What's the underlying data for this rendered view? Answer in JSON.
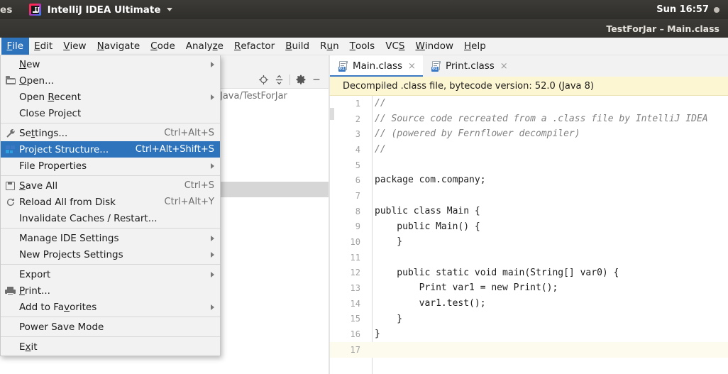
{
  "os_panel": {
    "activities_label": "es",
    "app_name": "IntelliJ IDEA Ultimate",
    "caret_icon": "chevron-down-icon",
    "logo_icon": "intellij-idea-logo",
    "clock": "Sun 16:57",
    "indicator_icon": "status-dot-icon"
  },
  "ide_titlebar": {
    "title": "TestForJar – Main.class"
  },
  "menubar": {
    "items": [
      {
        "label": "File",
        "mnemonic": "F",
        "active": true
      },
      {
        "label": "Edit",
        "mnemonic": "E",
        "active": false
      },
      {
        "label": "View",
        "mnemonic": "V",
        "active": false
      },
      {
        "label": "Navigate",
        "mnemonic": "N",
        "active": false
      },
      {
        "label": "Code",
        "mnemonic": "C",
        "active": false
      },
      {
        "label": "Analyze",
        "mnemonic": "z",
        "active": false
      },
      {
        "label": "Refactor",
        "mnemonic": "R",
        "active": false
      },
      {
        "label": "Build",
        "mnemonic": "B",
        "active": false
      },
      {
        "label": "Run",
        "mnemonic": "u",
        "active": false
      },
      {
        "label": "Tools",
        "mnemonic": "T",
        "active": false
      },
      {
        "label": "VCS",
        "mnemonic": "S",
        "active": false
      },
      {
        "label": "Window",
        "mnemonic": "W",
        "active": false
      },
      {
        "label": "Help",
        "mnemonic": "H",
        "active": false
      }
    ]
  },
  "file_menu": {
    "name": "File",
    "items": [
      {
        "label": "New",
        "mnemonic": "N",
        "icon": null,
        "accel": "",
        "submenu": true,
        "selected": false
      },
      {
        "label": "Open...",
        "mnemonic": "O",
        "icon": "folder-icon",
        "accel": "",
        "submenu": false,
        "selected": false
      },
      {
        "label": "Open Recent",
        "mnemonic": "R",
        "icon": null,
        "accel": "",
        "submenu": true,
        "selected": false
      },
      {
        "label": "Close Project",
        "mnemonic": "",
        "icon": null,
        "accel": "",
        "submenu": false,
        "selected": false
      },
      {
        "separator": true
      },
      {
        "label": "Settings...",
        "mnemonic": "t",
        "icon": "wrench-icon",
        "accel": "Ctrl+Alt+S",
        "submenu": false,
        "selected": false
      },
      {
        "label": "Project Structure...",
        "mnemonic": "",
        "icon": "project-structure-icon",
        "accel": "Ctrl+Alt+Shift+S",
        "submenu": false,
        "selected": true
      },
      {
        "label": "File Properties",
        "mnemonic": "",
        "icon": null,
        "accel": "",
        "submenu": true,
        "selected": false
      },
      {
        "separator": true
      },
      {
        "label": "Save All",
        "mnemonic": "S",
        "icon": "save-icon",
        "accel": "Ctrl+S",
        "submenu": false,
        "selected": false
      },
      {
        "label": "Reload All from Disk",
        "mnemonic": "",
        "icon": "reload-icon",
        "accel": "Ctrl+Alt+Y",
        "submenu": false,
        "selected": false
      },
      {
        "label": "Invalidate Caches / Restart...",
        "mnemonic": "",
        "icon": null,
        "accel": "",
        "submenu": false,
        "selected": false
      },
      {
        "separator": true
      },
      {
        "label": "Manage IDE Settings",
        "mnemonic": "",
        "icon": null,
        "accel": "",
        "submenu": true,
        "selected": false
      },
      {
        "label": "New Projects Settings",
        "mnemonic": "",
        "icon": null,
        "accel": "",
        "submenu": true,
        "selected": false
      },
      {
        "separator": true
      },
      {
        "label": "Export",
        "mnemonic": "",
        "icon": null,
        "accel": "",
        "submenu": true,
        "selected": false
      },
      {
        "label": "Print...",
        "mnemonic": "P",
        "icon": "printer-icon",
        "accel": "",
        "submenu": false,
        "selected": false
      },
      {
        "label": "Add to Favorites",
        "mnemonic": "v",
        "icon": null,
        "accel": "",
        "submenu": true,
        "selected": false
      },
      {
        "separator": true
      },
      {
        "label": "Power Save Mode",
        "mnemonic": "",
        "icon": null,
        "accel": "",
        "submenu": false,
        "selected": false
      },
      {
        "separator": true
      },
      {
        "label": "Exit",
        "mnemonic": "x",
        "icon": null,
        "accel": "",
        "submenu": false,
        "selected": false
      }
    ]
  },
  "project_panel": {
    "path_label": "Java/TestForJar",
    "toolbar_icons": [
      "locate-target-icon",
      "collapse-all-icon",
      "gear-icon",
      "hide-panel-icon"
    ]
  },
  "editor": {
    "tabs": [
      {
        "label": "Main.class",
        "icon": "java-class-file-icon",
        "badge": "01",
        "active": true,
        "close_icon": "close-icon"
      },
      {
        "label": "Print.class",
        "icon": "java-class-file-icon",
        "badge": "01",
        "active": false,
        "close_icon": "close-icon"
      }
    ],
    "banner": "Decompiled .class file, bytecode version: 52.0 (Java 8)",
    "lines": [
      {
        "n": "1",
        "text": "//",
        "style": "cmt",
        "caret": false
      },
      {
        "n": "2",
        "text": "// Source code recreated from a .class file by IntelliJ IDEA",
        "style": "cmt",
        "caret": false
      },
      {
        "n": "3",
        "text": "// (powered by Fernflower decompiler)",
        "style": "cmt",
        "caret": false
      },
      {
        "n": "4",
        "text": "//",
        "style": "cmt",
        "caret": false
      },
      {
        "n": "5",
        "text": "",
        "style": "",
        "caret": false
      },
      {
        "n": "6",
        "text": "package com.company;",
        "style": "",
        "caret": false
      },
      {
        "n": "7",
        "text": "",
        "style": "",
        "caret": false
      },
      {
        "n": "8",
        "text": "public class Main {",
        "style": "",
        "caret": false
      },
      {
        "n": "9",
        "text": "    public Main() {",
        "style": "",
        "caret": false
      },
      {
        "n": "10",
        "text": "    }",
        "style": "",
        "caret": false
      },
      {
        "n": "11",
        "text": "",
        "style": "",
        "caret": false
      },
      {
        "n": "12",
        "text": "    public static void main(String[] var0) {",
        "style": "",
        "caret": false
      },
      {
        "n": "13",
        "text": "        Print var1 = new Print();",
        "style": "",
        "caret": false
      },
      {
        "n": "14",
        "text": "        var1.test();",
        "style": "",
        "caret": false
      },
      {
        "n": "15",
        "text": "    }",
        "style": "",
        "caret": false
      },
      {
        "n": "16",
        "text": "}",
        "style": "",
        "caret": false
      },
      {
        "n": "17",
        "text": "",
        "style": "",
        "caret": true
      }
    ]
  },
  "colors": {
    "menu_highlight": "#2d74bd",
    "banner_bg": "#fdf6d3",
    "tab_underline": "#3b79c4",
    "panel_bg": "#f2f2f2",
    "os_panel_bg": "#3c3b37"
  }
}
